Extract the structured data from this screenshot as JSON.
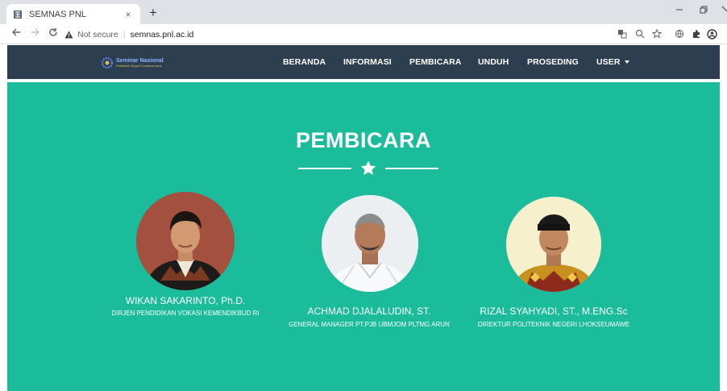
{
  "browser": {
    "tab_title": "SEMNAS PNL",
    "tab_close": "×",
    "new_tab": "+",
    "security_label": "Not secure",
    "separator": "|",
    "url": "semnas.pnl.ac.id",
    "icons": [
      "back-icon",
      "forward-icon",
      "reload-icon",
      "warning-icon",
      "translate-icon",
      "zoom-icon",
      "bookmark-star-icon",
      "extension-globe-icon",
      "extensions-puzzle-icon",
      "profile-icon"
    ]
  },
  "site": {
    "logo": {
      "line1": "Seminar Nasional",
      "line2": "Politeknik Negeri Lhokseumawe"
    },
    "nav": {
      "items": [
        "BERANDA",
        "INFORMASI",
        "PEMBICARA",
        "UNDUH",
        "PROSEDING",
        "USER"
      ]
    }
  },
  "section": {
    "title": "PEMBICARA",
    "speakers": [
      {
        "name": "WIKAN SAKARINTO, Ph.D.",
        "role": "DIRJEN PENDIDIKAN VOKASI KEMENDIKBUD RI"
      },
      {
        "name": "ACHMAD DJALALUDIN, ST.",
        "role": "GENERAL MANAGER PT.PJB UBMJOM PLTMG ARUN"
      },
      {
        "name": "RIZAL SYAHYADI, ST., M.ENG.Sc",
        "role": "DIREKTUR POLITEKNIK NEGERI LHOKSEUMAWE"
      }
    ]
  },
  "colors": {
    "navbar": "#2c3e50",
    "hero": "#1abc9c",
    "text": "#ffffff"
  }
}
